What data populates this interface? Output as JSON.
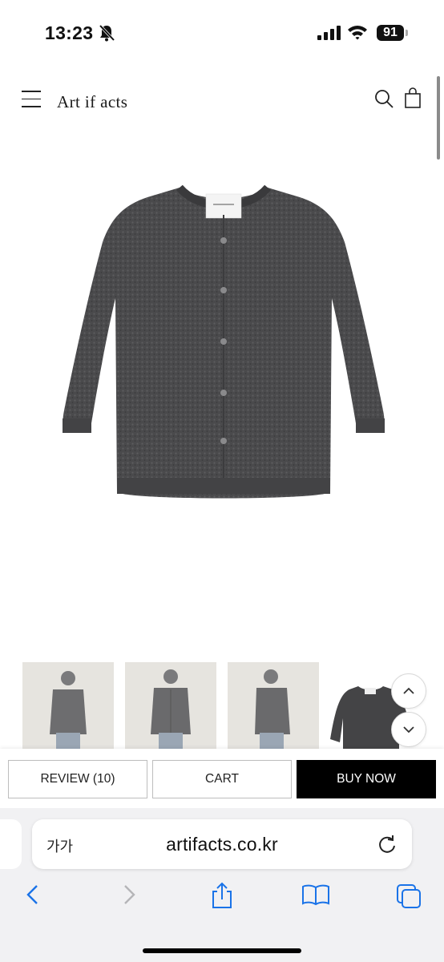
{
  "status_bar": {
    "time": "13:23",
    "battery": "91",
    "icons": [
      "bell-slash-icon",
      "signal-icon",
      "wifi-icon",
      "battery-icon"
    ]
  },
  "header": {
    "logo": "Art if acts",
    "icons": [
      "menu-icon",
      "search-icon",
      "bag-icon"
    ]
  },
  "product": {
    "image_desc_icon": "cardigan-image",
    "sweater_color": "#4a4a4c"
  },
  "thumbnails": {
    "count": 4,
    "icons": [
      "chevron-up-icon",
      "chevron-down-icon"
    ]
  },
  "actions": {
    "review_label": "REVIEW (10)",
    "cart_label": "CART",
    "buy_label": "BUY NOW"
  },
  "browser": {
    "aa_label": "가가",
    "url": "artifacts.co.kr",
    "icons": [
      "back-icon",
      "forward-icon",
      "share-icon",
      "bookmarks-icon",
      "tabs-icon",
      "reload-icon"
    ],
    "accent": "#1a73e8"
  }
}
